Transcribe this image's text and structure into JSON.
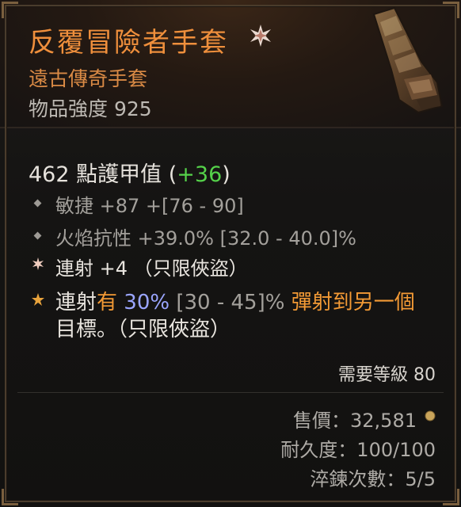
{
  "item": {
    "name": "反覆冒險者手套",
    "type": "遠古傳奇手套",
    "item_power": "物品強度 925",
    "armor_value": "462 點護甲值",
    "armor_delta_open": "(",
    "armor_delta": "+36",
    "armor_delta_close": ")",
    "icon": "gauntlet-icon",
    "star_icon": "legendary-star-icon"
  },
  "affixes": [
    {
      "text": "敏捷 +87 +[76 - 90]"
    },
    {
      "text": "火焰抗性 +39.0% [32.0 - 40.0]%"
    },
    {
      "text": "連射 +4 （只限俠盜）"
    }
  ],
  "legendary": {
    "part1": "連射",
    "part2": "有",
    "value": "30%",
    "range": "[30 - 45]%",
    "part3": "彈射到另一個",
    "line2": "目標。（只限俠盜）"
  },
  "requirement": "需要等級 80",
  "sell_value": "售價：32,581",
  "durability": "耐久度：100/100",
  "tempers": "淬鍊次數：5/5",
  "colors": {
    "title": "#ef8f3c",
    "legendary_text": "#f39a35",
    "positive": "#55d24a",
    "value_highlight": "#9aa5ff"
  }
}
